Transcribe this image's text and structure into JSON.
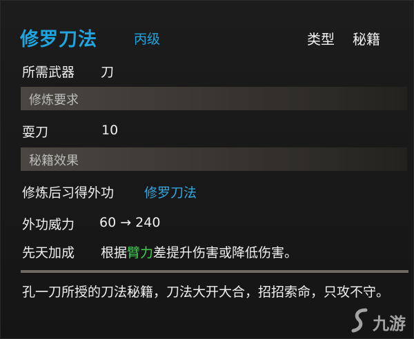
{
  "skill": {
    "name": "修罗刀法",
    "grade": "丙级",
    "type_label": "类型",
    "type_value": "秘籍"
  },
  "weapon": {
    "label": "所需武器",
    "value": "刀"
  },
  "requirements": {
    "section_title": "修炼要求",
    "label": "耍刀",
    "value": "10"
  },
  "effects": {
    "section_title": "秘籍效果",
    "learn_label": "修炼后习得外功",
    "learn_value": "修罗刀法",
    "power_label": "外功威力",
    "power_value": "60 → 240",
    "innate_label": "先天加成",
    "innate_prefix": "根据",
    "innate_attr": "臂力",
    "innate_suffix": "差提升伤害或降低伤害。"
  },
  "description": "孔一刀所授的刀法秘籍，刀法大开大合，招招索命，只攻不守。",
  "watermark": {
    "text": "九游"
  }
}
